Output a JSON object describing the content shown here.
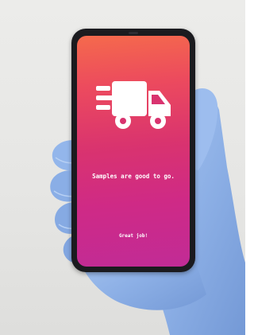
{
  "photo": {
    "subject": "gloved-hand-holding-phone",
    "glove_color": "#8fb3e8",
    "background_color": "#e7e7e5"
  },
  "phone_screen": {
    "icon": "delivery-truck-icon",
    "headline": "Samples are good to go.",
    "subline": "Great job!",
    "gradient_top": "#f56a4c",
    "gradient_bottom": "#c12b96"
  }
}
